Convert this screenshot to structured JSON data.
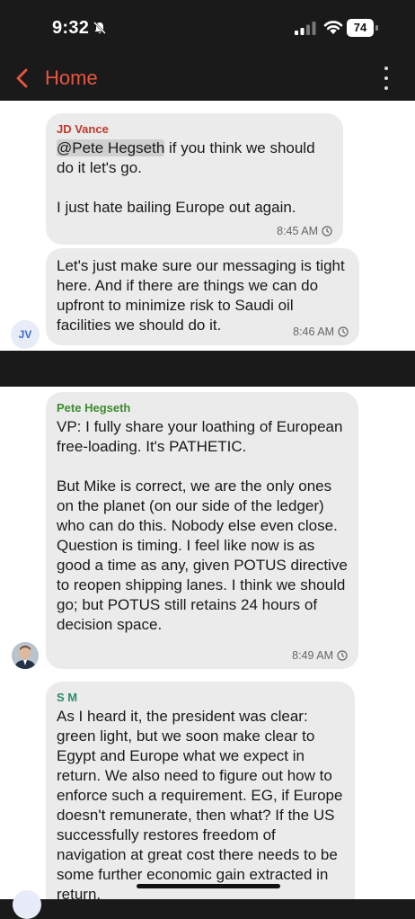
{
  "status": {
    "time": "9:32",
    "battery": "74"
  },
  "header": {
    "back_label": "Home"
  },
  "messages": [
    {
      "sender": "JD Vance",
      "sender_color": "#c0392b",
      "mention": "@Pete Hegseth",
      "text": " if you think we should do it let's go.\n\nI just hate bailing Europe out again.",
      "time": "8:45 AM"
    },
    {
      "text": "Let's just make sure our messaging is tight here. And if there are things we can do upfront to minimize risk to Saudi oil facilities we should do it.",
      "time": "8:46 AM",
      "avatar": "JV"
    },
    {
      "sender": "Pete Hegseth",
      "sender_color": "#3d8b2f",
      "text": "VP: I fully share your loathing of European free-loading. It's PATHETIC.\n\nBut Mike is correct, we are the only ones on the planet (on our side of the ledger) who can do this. Nobody else even close. Question is timing. I feel like now is as good a time as any, given POTUS directive to reopen shipping lanes. I think we should go; but POTUS still retains 24 hours of decision space.",
      "time": "8:49 AM"
    },
    {
      "sender": "S M",
      "sender_color": "#2e8b6f",
      "text": "As I heard it, the president was clear: green light, but we soon make clear to Egypt and Europe what we expect in return. We also need to figure out how to enforce such a requirement. EG, if Europe doesn't remunerate, then what? If the US successfully restores freedom of navigation at great cost there needs to be some further economic gain extracted in return."
    }
  ]
}
